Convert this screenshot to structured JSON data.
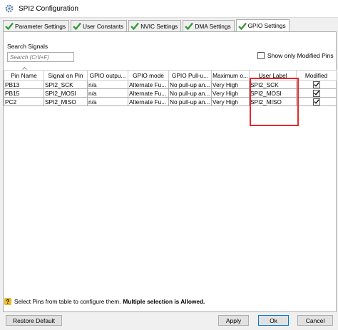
{
  "window": {
    "title": "SPI2 Configuration"
  },
  "tabs": [
    {
      "label": "Parameter Settings",
      "active": false
    },
    {
      "label": "User Constants",
      "active": false
    },
    {
      "label": "NVIC Settings",
      "active": false
    },
    {
      "label": "DMA Settings",
      "active": false
    },
    {
      "label": "GPIO Settings",
      "active": true
    }
  ],
  "search": {
    "label": "Search Signals",
    "placeholder": "Search (Crtl+F)"
  },
  "show_modified": {
    "label": "Show only Modified Pins",
    "checked": false
  },
  "table": {
    "columns": [
      "Pin Name",
      "Signal on Pin",
      "GPIO outpu...",
      "GPIO mode",
      "GPIO Pull-u...",
      "Maximum o...",
      "User Label",
      "Modified"
    ],
    "rows": [
      [
        "PB13",
        "SPI2_SCK",
        "n/a",
        "Alternate Fu...",
        "No pull-up an...",
        "Very High",
        "SPI2_SCK",
        "checked"
      ],
      [
        "PB15",
        "SPI2_MOSI",
        "n/a",
        "Alternate Fu...",
        "No pull-up an...",
        "Very High",
        "SPI2_MOSI",
        "checked"
      ],
      [
        "PC2",
        "SPI2_MISO",
        "n/a",
        "Alternate Fu...",
        "No pull-up an...",
        "Very High",
        "SPI2_MISO",
        "checked"
      ]
    ]
  },
  "status": {
    "text": "Select Pins from table to configure them. ",
    "bold_text": "Multiple selection is Allowed."
  },
  "buttons": {
    "restore": "Restore Default",
    "apply": "Apply",
    "ok": "Ok",
    "cancel": "Cancel"
  },
  "icons": {
    "tab_check": "check-icon",
    "status": "help-icon",
    "app": "gear-icon"
  },
  "colors": {
    "check_green": "#3a9a3a",
    "highlight_red": "#e8262c",
    "default_button_border": "#0078d7"
  }
}
